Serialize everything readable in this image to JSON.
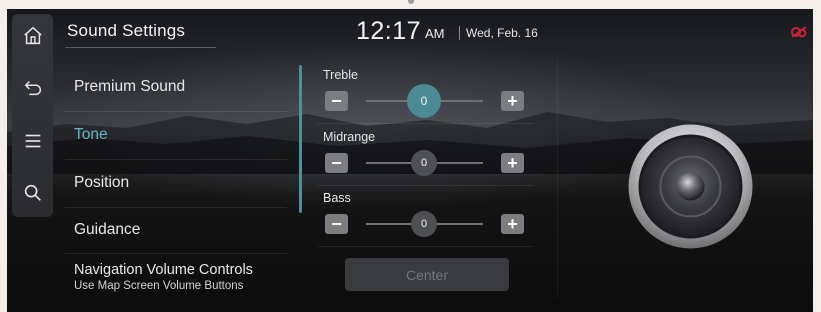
{
  "header": {
    "title": "Sound Settings",
    "time": "12:17",
    "ampm": "AM",
    "date": "Wed, Feb. 16",
    "status_icon": "sound-off-icon"
  },
  "rail": {
    "items": [
      {
        "icon": "home-icon"
      },
      {
        "icon": "back-icon"
      },
      {
        "icon": "menu-icon"
      },
      {
        "icon": "search-icon"
      }
    ]
  },
  "menu": {
    "items": [
      {
        "label": "Premium Sound"
      },
      {
        "label": "Tone",
        "active": true
      },
      {
        "label": "Position"
      },
      {
        "label": "Guidance"
      },
      {
        "label": "Navigation Volume Controls",
        "sub": "Use Map Screen Volume Buttons"
      }
    ]
  },
  "tone": {
    "treble": {
      "label": "Treble",
      "value": "0",
      "minus": "−",
      "plus": "+"
    },
    "midrange": {
      "label": "Midrange",
      "value": "0",
      "minus": "−",
      "plus": "+"
    },
    "bass": {
      "label": "Bass",
      "value": "0",
      "minus": "−",
      "plus": "+"
    },
    "center_label": "Center"
  },
  "colors": {
    "accent": "#63b7c6",
    "knob_active": "#4c8a94",
    "mute_red": "#c8243a"
  }
}
